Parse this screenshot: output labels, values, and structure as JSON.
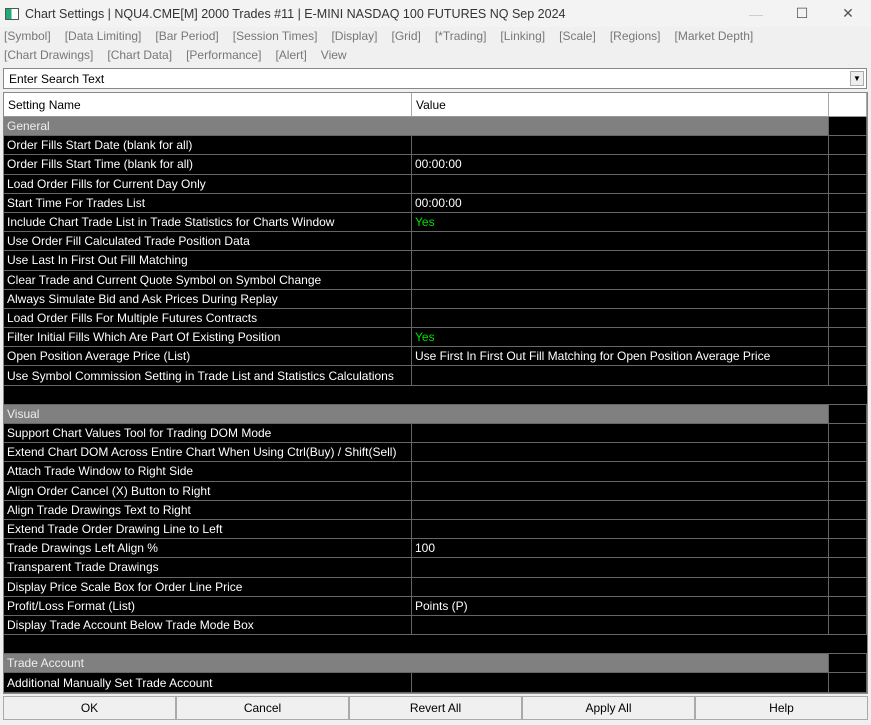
{
  "window": {
    "title": "Chart Settings | NQU4.CME[M]  2000 Trades #11 | E-MINI NASDAQ 100 FUTURES NQ Sep 2024",
    "minimize": "—",
    "maximize": "☐",
    "close": "✕"
  },
  "menu_row1": [
    "[Symbol]",
    "[Data Limiting]",
    "[Bar Period]",
    "[Session Times]",
    "[Display]",
    "[Grid]",
    "[*Trading]",
    "[Linking]",
    "[Scale]",
    "[Regions]",
    "[Market Depth]"
  ],
  "menu_row2": [
    "[Chart Drawings]",
    "[Chart Data]",
    "[Performance]",
    "[Alert]",
    "View"
  ],
  "search": {
    "value": "Enter Search Text",
    "dropdown": "▼"
  },
  "columns": {
    "name": "Setting Name",
    "value": "Value"
  },
  "groups": [
    {
      "title": "General",
      "rows": [
        {
          "name": "Order Fills Start Date (blank for all)",
          "value": ""
        },
        {
          "name": "Order Fills Start Time (blank for all)",
          "value": "00:00:00"
        },
        {
          "name": "Load Order Fills for Current Day Only",
          "value": ""
        },
        {
          "name": "Start Time For Trades List",
          "value": "00:00:00"
        },
        {
          "name": "Include Chart Trade List in Trade Statistics for Charts Window",
          "value": "Yes"
        },
        {
          "name": "Use Order Fill Calculated Trade Position Data",
          "value": ""
        },
        {
          "name": "Use Last In First Out Fill Matching",
          "value": ""
        },
        {
          "name": "Clear Trade and Current Quote Symbol on Symbol Change",
          "value": ""
        },
        {
          "name": "Always Simulate Bid and Ask Prices During Replay",
          "value": ""
        },
        {
          "name": "Load Order Fills For Multiple Futures Contracts",
          "value": ""
        },
        {
          "name": "Filter Initial Fills Which Are Part Of Existing Position",
          "value": "Yes"
        },
        {
          "name": "Open Position Average Price (List)",
          "value": "Use First In First Out Fill Matching for Open Position Average Price"
        },
        {
          "name": "Use Symbol Commission Setting in Trade List and Statistics Calculations",
          "value": ""
        }
      ]
    },
    {
      "title": "Visual",
      "rows": [
        {
          "name": "Support Chart Values Tool for Trading DOM Mode",
          "value": ""
        },
        {
          "name": "Extend Chart DOM Across Entire Chart When Using Ctrl(Buy) / Shift(Sell)",
          "value": ""
        },
        {
          "name": "Attach Trade Window to Right Side",
          "value": ""
        },
        {
          "name": "Align Order Cancel (X) Button to Right",
          "value": ""
        },
        {
          "name": "Align Trade Drawings Text to Right",
          "value": ""
        },
        {
          "name": "Extend Trade Order Drawing Line to Left",
          "value": ""
        },
        {
          "name": "Trade Drawings Left Align %",
          "value": "100"
        },
        {
          "name": "Transparent Trade Drawings",
          "value": ""
        },
        {
          "name": "Display Price Scale Box for Order Line Price",
          "value": ""
        },
        {
          "name": "Profit/Loss Format (List)",
          "value": "Points (P)"
        },
        {
          "name": "Display Trade Account Below Trade Mode Box",
          "value": ""
        }
      ]
    },
    {
      "title": "Trade Account",
      "rows": [
        {
          "name": "Additional Manually Set Trade Account",
          "value": ""
        }
      ]
    }
  ],
  "buttons": {
    "ok": "OK",
    "cancel": "Cancel",
    "revert": "Revert All",
    "apply": "Apply All",
    "help": "Help"
  }
}
